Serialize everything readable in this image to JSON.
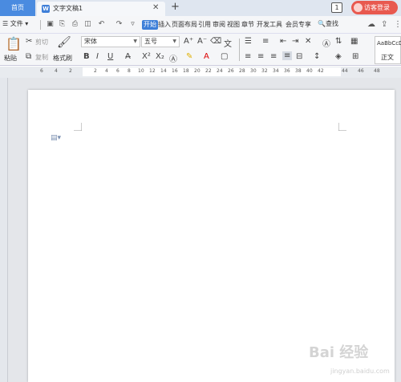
{
  "tabs": {
    "home": "首页",
    "document_title": "文字文稿1",
    "doc_icon": "W",
    "close": "✕",
    "add": "+"
  },
  "titlebar": {
    "badge": "1",
    "login": "访客登录"
  },
  "menu": {
    "file": "☰ 文件 ▾",
    "items": [
      "开始",
      "插入",
      "页面布局",
      "引用",
      "审阅",
      "视图",
      "章节",
      "开发工具",
      "会员专享"
    ],
    "active_index": 0,
    "search": "🔍查找"
  },
  "ribbon": {
    "paste": "粘贴",
    "cut": "剪切",
    "copy": "复制",
    "format_painter": "格式刷",
    "font_name": "宋体",
    "font_size": "五号",
    "style_sample": "AaBbCcDd",
    "style_name": "正文",
    "bold": "B",
    "italic": "I",
    "underline": "U",
    "superscript": "X²",
    "subscript": "X₂"
  },
  "ruler": {
    "ticks": [
      "6",
      "4",
      "2",
      "2",
      "4",
      "6",
      "8",
      "10",
      "12",
      "14",
      "16",
      "18",
      "20",
      "22",
      "24",
      "26",
      "28",
      "30",
      "32",
      "34",
      "36",
      "38",
      "40",
      "42",
      "44",
      "46",
      "48"
    ]
  },
  "watermark": {
    "main": "Bai 经验",
    "sub": "jingyan.baidu.com"
  }
}
